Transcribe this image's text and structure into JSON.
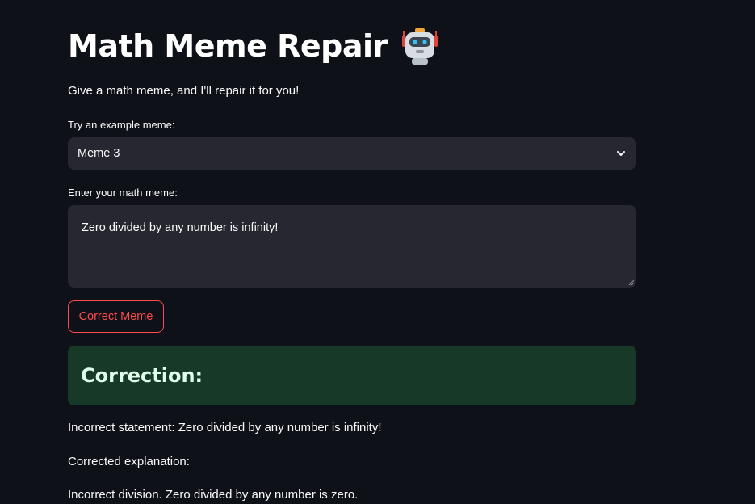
{
  "header": {
    "title": "Math Meme Repair",
    "subtitle": "Give a math meme, and I'll repair it for you!"
  },
  "example_select": {
    "label": "Try an example meme:",
    "selected": "Meme 3"
  },
  "meme_input": {
    "label": "Enter your math meme:",
    "value": "Zero divided by any number is infinity!"
  },
  "actions": {
    "correct_label": "Correct Meme"
  },
  "result": {
    "heading": "Correction:",
    "incorrect_statement": "Incorrect statement: Zero divided by any number is infinity!",
    "explanation_label": "Corrected explanation:",
    "explanation": "Incorrect division. Zero divided by any number is zero."
  },
  "colors": {
    "background": "#0e1117",
    "widget": "#262730",
    "accent": "#ff4b4b",
    "success_bg": "#173928",
    "success_text": "#dffde9"
  },
  "icons": {
    "title_emoji": "robot-icon",
    "dropdown": "chevron-down-icon"
  }
}
